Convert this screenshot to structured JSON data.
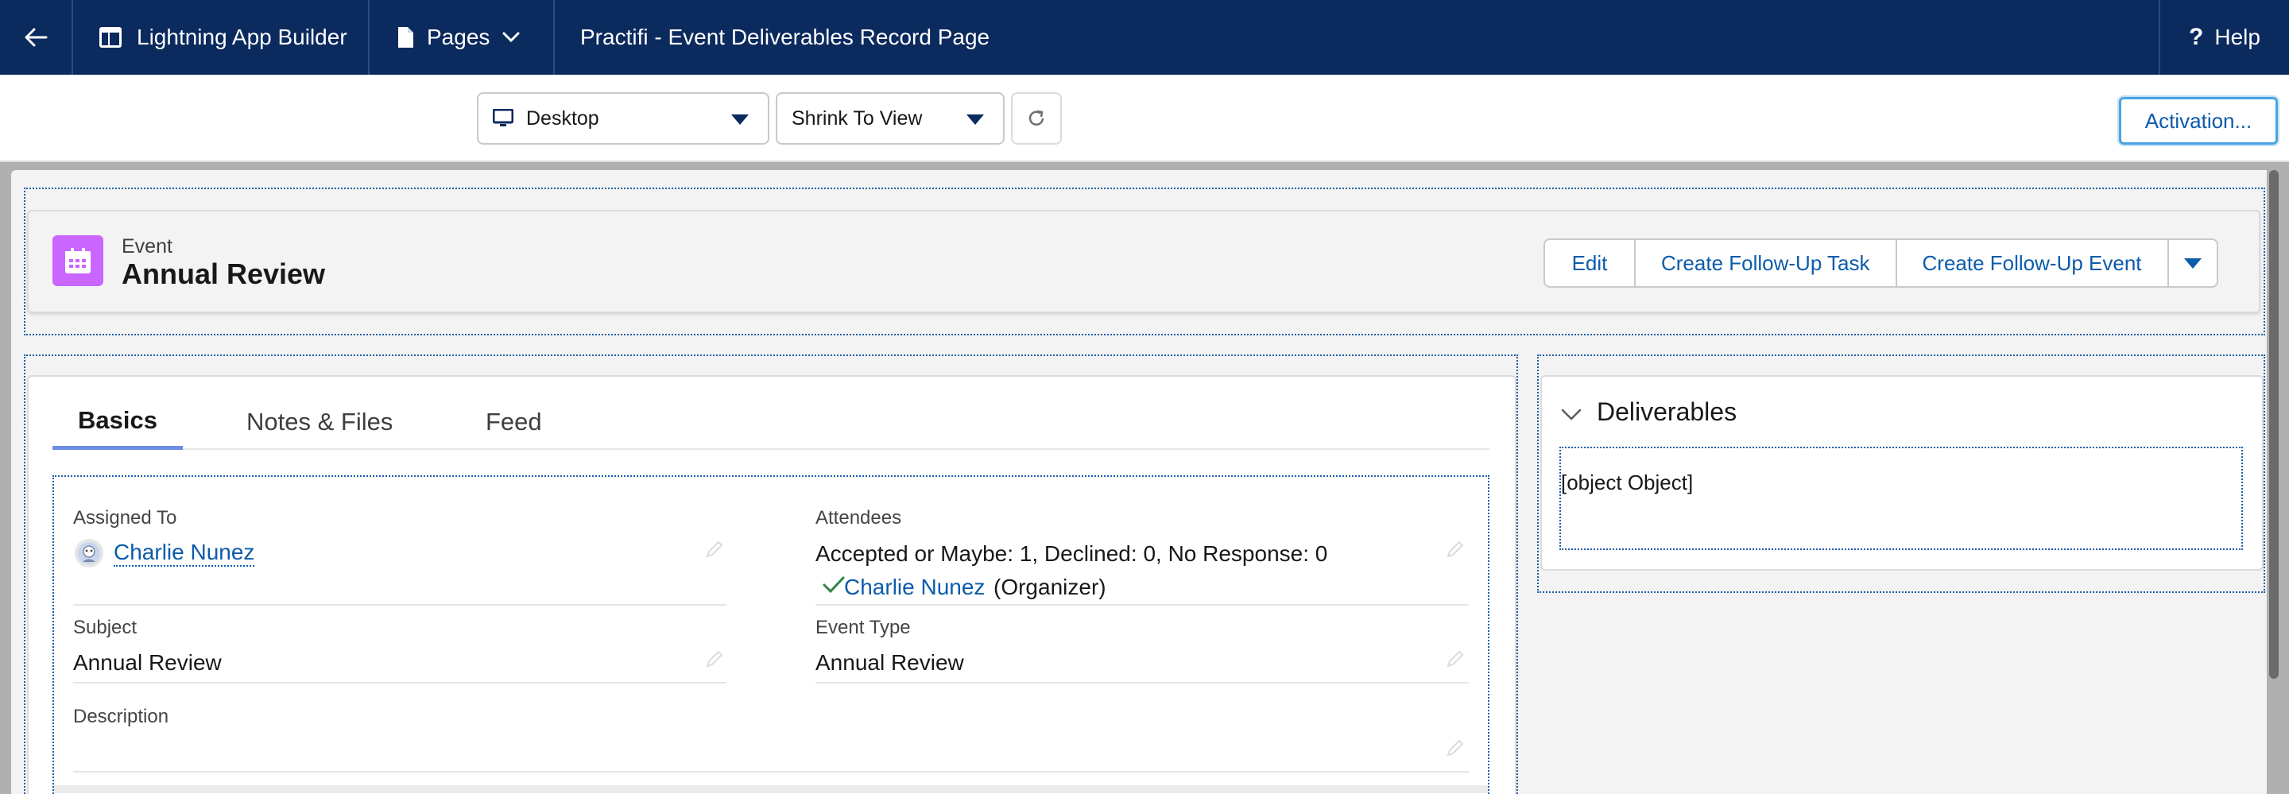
{
  "topbar": {
    "back_icon": "arrow-left-icon",
    "app_icon": "layout-icon",
    "app_name": "Lightning App Builder",
    "pages_icon": "page-icon",
    "pages_label": "Pages",
    "page_title": "Practifi - Event Deliverables Record Page",
    "help_label": "Help"
  },
  "toolbar": {
    "device_selected": "Desktop",
    "zoom_selected": "Shrink To View",
    "refresh_icon": "refresh-icon",
    "activation_label": "Activation..."
  },
  "highlights": {
    "object_type": "Event",
    "record_name": "Annual Review",
    "icon_color": "#cb65ff",
    "actions": [
      "Edit",
      "Create Follow-Up Task",
      "Create Follow-Up Event"
    ]
  },
  "tabs": [
    {
      "label": "Basics",
      "active": true
    },
    {
      "label": "Notes & Files",
      "active": false
    },
    {
      "label": "Feed",
      "active": false
    }
  ],
  "fields": {
    "assigned_to_label": "Assigned To",
    "assigned_to_value": "Charlie Nunez",
    "attendees_label": "Attendees",
    "attendees_summary": "Accepted or Maybe: 1, Declined: 0, No Response: 0",
    "attendee_name": "Charlie Nunez",
    "attendee_role": "(Organizer)",
    "subject_label": "Subject",
    "subject_value": "Annual Review",
    "event_type_label": "Event Type",
    "event_type_value": "Annual Review",
    "description_label": "Description",
    "description_value": ""
  },
  "deliverables": {
    "title": "Deliverables",
    "content": "[object Object]"
  },
  "colors": {
    "nav_bg": "#0b2a5e",
    "link": "#0b5cab",
    "canvas_bg": "#b0b0b0"
  }
}
